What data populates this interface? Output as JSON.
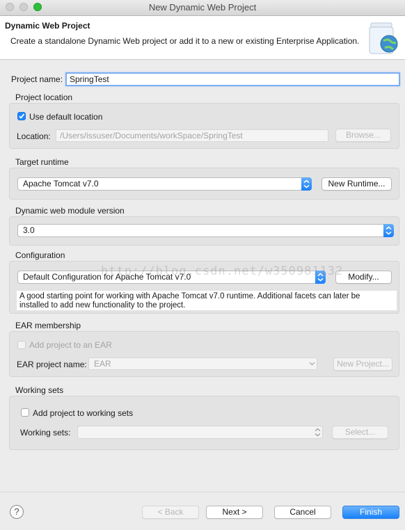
{
  "window": {
    "title": "New Dynamic Web Project"
  },
  "banner": {
    "title": "Dynamic Web Project",
    "description": "Create a standalone Dynamic Web project or add it to a new or existing Enterprise Application.",
    "icon": "jar-globe-icon"
  },
  "project_name": {
    "label": "Project name:",
    "value": "SpringTest"
  },
  "project_location": {
    "heading": "Project location",
    "use_default_label": "Use default location",
    "use_default_checked": true,
    "location_label": "Location:",
    "location_value": "/Users/issuser/Documents/workSpace/SpringTest",
    "browse_label": "Browse..."
  },
  "target_runtime": {
    "heading": "Target runtime",
    "selected": "Apache Tomcat v7.0",
    "new_runtime_label": "New Runtime..."
  },
  "web_module": {
    "heading": "Dynamic web module version",
    "selected": "3.0"
  },
  "configuration": {
    "heading": "Configuration",
    "selected": "Default Configuration for Apache Tomcat v7.0",
    "modify_label": "Modify...",
    "description_line1": "A good starting point for working with Apache Tomcat v7.0 runtime. Additional facets can later be",
    "description_line2": "installed to add new functionality to the project."
  },
  "watermark": "http://blog.csdn.net/w350981132",
  "ear": {
    "heading": "EAR membership",
    "add_label": "Add project to an EAR",
    "add_checked": false,
    "name_label": "EAR project name:",
    "name_value": "EAR",
    "new_project_label": "New Project..."
  },
  "working_sets": {
    "heading": "Working sets",
    "add_label": "Add project to working sets",
    "add_checked": false,
    "sets_label": "Working sets:",
    "sets_value": "",
    "select_label": "Select..."
  },
  "footer": {
    "help_label": "?",
    "back_label": "< Back",
    "next_label": "Next >",
    "cancel_label": "Cancel",
    "finish_label": "Finish"
  },
  "colors": {
    "accent": "#1f87fb",
    "window_bg": "#ececec",
    "group_bg": "#e3e3e3"
  }
}
